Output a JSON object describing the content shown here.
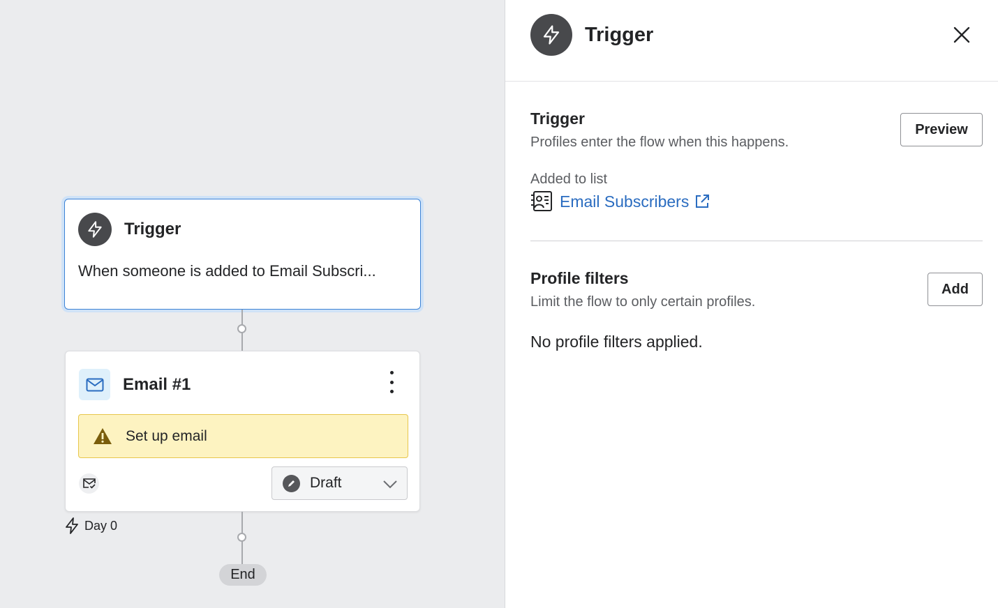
{
  "canvas": {
    "trigger_node": {
      "title": "Trigger",
      "description": "When someone is added to Email Subscri...",
      "icon": "lightning-icon"
    },
    "email_node": {
      "title": "Email #1",
      "icon": "mail-icon",
      "warning": "Set up email",
      "status_select": "Draft"
    },
    "delay_label": "Day 0",
    "end_label": "End"
  },
  "panel": {
    "title": "Trigger",
    "trigger_section": {
      "title": "Trigger",
      "subtitle": "Profiles enter the flow when this happens.",
      "preview_button": "Preview",
      "added_label": "Added to list",
      "list_name": "Email Subscribers"
    },
    "filters_section": {
      "title": "Profile filters",
      "subtitle": "Limit the flow to only certain profiles.",
      "add_button": "Add",
      "empty_text": "No profile filters applied."
    }
  },
  "colors": {
    "accent": "#3b82d6",
    "link": "#2a6cc0",
    "warning_bg": "#fdf3c1",
    "canvas_bg": "#ebecee"
  }
}
